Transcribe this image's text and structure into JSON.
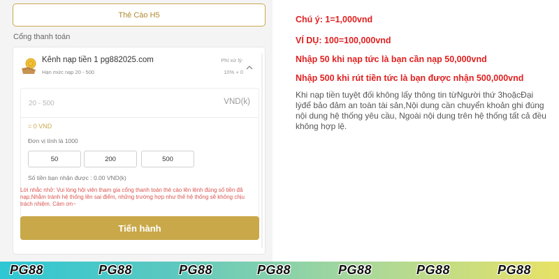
{
  "tab": {
    "label": "Thẻ Cào H5"
  },
  "section": {
    "label": "Cổng thanh toán"
  },
  "channel": {
    "name": "Kênh nạp tiền 1 pg882025.com",
    "limit": "Hạn mức nạp 20 - 500",
    "fee_label": "Phí xử lý:",
    "fee_value": "10% + 0",
    "icon": "coin-icon"
  },
  "deposit": {
    "placeholder": "20 - 500",
    "currency": "VND(k)",
    "converted": "= 0 VND",
    "unit_note": "Đơn vị tính là 1000",
    "quick_amounts": [
      "50",
      "200",
      "500"
    ],
    "received": "Số tiền bạn nhận được : 0.00 VND(k)"
  },
  "reminder": "Lời nhắc nhở: Vui lòng hội viên tham gia cổng thanh toán thẻ cào lên lệnh đúng số tiền đã nạp.Nhằm tránh hệ thống lên sai điểm, những trường hợp như thế hệ thống sẽ không chịu trách nhiệm. Cảm ơn~",
  "proceed_label": "Tiến hành",
  "notes": [
    "Chú ý: 1=1,000vnd",
    "VÍ DỤ: 100=100,000vnd",
    "Nhập 50 khi nạp tức là bạn cần nạp 50,000vnd",
    "Nhập 500 khi rút tiền tức là bạn được nhận 500,000vnd"
  ],
  "info_text": "Khi nạp tiền tuyệt đối không lấy thông tin từNgười thứ 3hoặcĐại lýđể bảo đảm an toàn tài sản,Nội dung cần chuyển khoản ghi đúng nội dung hệ thống yêu cầu, Ngoài nội dung trên hệ thống tất cả đều không hợp lệ.",
  "watermarks": [
    "PG88",
    "PG88",
    "PG88",
    "PG88",
    "PG88",
    "PG88",
    "PG88"
  ],
  "colors": {
    "gold": "#c9a84a",
    "warning_red": "#e02020",
    "strip_start": "#2ec7d4",
    "strip_end": "#e8e266"
  }
}
